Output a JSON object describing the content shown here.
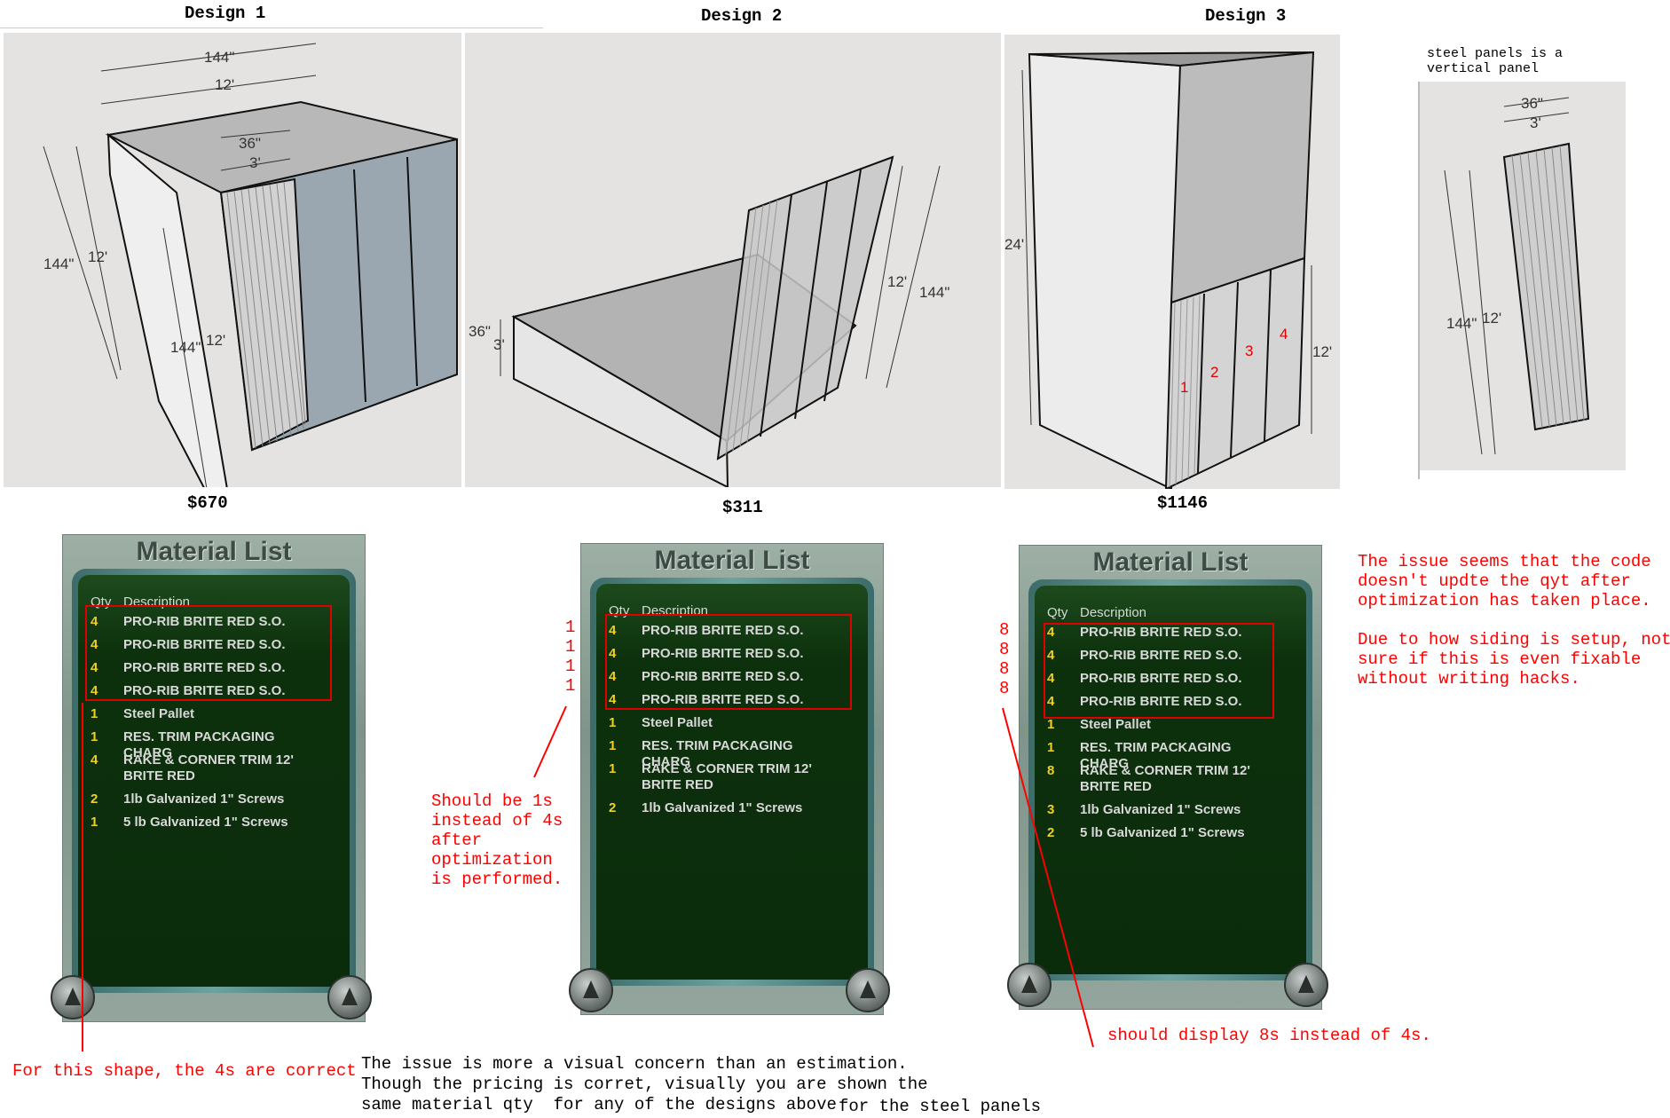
{
  "designs": [
    {
      "title": "Design 1",
      "price": "$670"
    },
    {
      "title": "Design 2",
      "price": "$311"
    },
    {
      "title": "Design 3",
      "price": "$1146"
    }
  ],
  "side_note": "steel panels is a\nvertical panel",
  "dims": {
    "d1": [
      "144\"",
      "12'",
      "36\"",
      "3'",
      "144\"",
      "12'",
      "144\"",
      "12'"
    ],
    "d2": [
      "36\"",
      "3'",
      "12'",
      "144\""
    ],
    "d3": [
      "24'",
      "12'",
      "1",
      "2",
      "3",
      "4"
    ],
    "side": [
      "36\"",
      "3'",
      "144\"",
      "12'"
    ]
  },
  "material_list": {
    "title": "Material List",
    "col_qty": "Qty",
    "col_desc": "Description",
    "lists": [
      {
        "rows": [
          {
            "qty": "4",
            "desc": "PRO-RIB BRITE RED S.O."
          },
          {
            "qty": "4",
            "desc": "PRO-RIB BRITE RED S.O."
          },
          {
            "qty": "4",
            "desc": "PRO-RIB BRITE RED S.O."
          },
          {
            "qty": "4",
            "desc": "PRO-RIB BRITE RED S.O."
          },
          {
            "qty": "1",
            "desc": "Steel Pallet"
          },
          {
            "qty": "1",
            "desc": "RES. TRIM PACKAGING CHARG"
          },
          {
            "qty": "4",
            "desc": "RAKE & CORNER TRIM 12' BRITE RED"
          },
          {
            "qty": "2",
            "desc": "1lb Galvanized 1\" Screws"
          },
          {
            "qty": "1",
            "desc": "5 lb Galvanized 1\" Screws"
          }
        ]
      },
      {
        "rows": [
          {
            "qty": "4",
            "desc": "PRO-RIB BRITE RED S.O."
          },
          {
            "qty": "4",
            "desc": "PRO-RIB BRITE RED S.O."
          },
          {
            "qty": "4",
            "desc": "PRO-RIB BRITE RED S.O."
          },
          {
            "qty": "4",
            "desc": "PRO-RIB BRITE RED S.O."
          },
          {
            "qty": "1",
            "desc": "Steel Pallet"
          },
          {
            "qty": "1",
            "desc": "RES. TRIM PACKAGING CHARG"
          },
          {
            "qty": "1",
            "desc": "RAKE & CORNER TRIM 12' BRITE RED"
          },
          {
            "qty": "2",
            "desc": "1lb Galvanized 1\" Screws"
          }
        ]
      },
      {
        "rows": [
          {
            "qty": "4",
            "desc": "PRO-RIB BRITE RED S.O."
          },
          {
            "qty": "4",
            "desc": "PRO-RIB BRITE RED S.O."
          },
          {
            "qty": "4",
            "desc": "PRO-RIB BRITE RED S.O."
          },
          {
            "qty": "4",
            "desc": "PRO-RIB BRITE RED S.O."
          },
          {
            "qty": "1",
            "desc": "Steel Pallet"
          },
          {
            "qty": "1",
            "desc": "RES. TRIM PACKAGING CHARG"
          },
          {
            "qty": "8",
            "desc": "RAKE & CORNER TRIM 12' BRITE RED"
          },
          {
            "qty": "3",
            "desc": "1lb Galvanized 1\" Screws"
          },
          {
            "qty": "2",
            "desc": "5 lb Galvanized 1\" Screws"
          }
        ]
      }
    ]
  },
  "annotations": {
    "ones": [
      "1",
      "1",
      "1",
      "1"
    ],
    "eights": [
      "8",
      "8",
      "8",
      "8"
    ],
    "should_be_1s": "Should be 1s\ninstead of 4s\nafter\noptimization\nis performed.",
    "should_display_8s": "should display 8s instead of 4s.",
    "four_correct": "For this shape, the 4s are correct",
    "issue_code": "The issue seems that the code\ndoesn't updte the qyt after\noptimization has taken place.\n\nDue to how siding is setup, not\nsure if this is even fixable\nwithout writing hacks.",
    "visual_concern": "The issue is more a visual concern than an estimation.\nThough the pricing is corret, visually you are shown the\nsame material qty  for any of the designs above",
    "for_steel": "for the steel panels"
  },
  "colors": {
    "accent_red": "#ff0000",
    "qty_yellow": "#f0d020",
    "screen_green": "#0b2c0b"
  }
}
